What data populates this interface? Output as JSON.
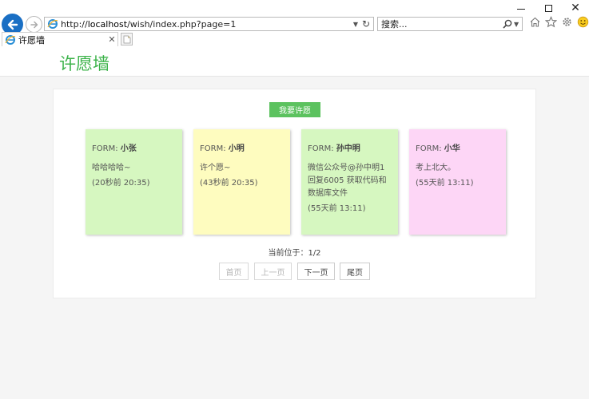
{
  "browser": {
    "url_prefix": "http://",
    "url_host": "localhost",
    "url_path": "/wish/index.php?page=1",
    "search_value": "搜索...",
    "tab_title": "许愿墙",
    "window": {
      "minimize": "─",
      "maximize": "□",
      "close": "✕"
    }
  },
  "page": {
    "title": "许愿墙",
    "wish_button": "我要许愿",
    "from_label": "FORM:",
    "cards": [
      {
        "name": "小张",
        "content": "哈哈哈哈~",
        "time": "(20秒前 20:35)",
        "color": "#d6f7c0"
      },
      {
        "name": "小明",
        "content": "许个愿~",
        "time": "(43秒前 20:35)",
        "color": "#fefcbf"
      },
      {
        "name": "孙中明",
        "content": "微信公众号@孙中明1回复6005 获取代码和数据库文件",
        "time": "(55天前 13:11)",
        "color": "#d6f7c0"
      },
      {
        "name": "小华",
        "content": "考上北大。",
        "time": "(55天前 13:11)",
        "color": "#fdd6f6"
      }
    ],
    "pagination": {
      "status": "当前位于：1/2",
      "first": "首页",
      "prev": "上一页",
      "next": "下一页",
      "last": "尾页"
    }
  },
  "colors": {
    "accent_green": "#3cb34a",
    "button_green": "#5cc25f",
    "ie_blue": "#1a6fc4"
  }
}
